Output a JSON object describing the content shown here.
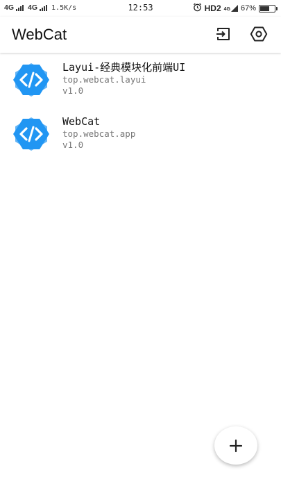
{
  "status_bar": {
    "network1": "4G",
    "network2": "4G",
    "speed": "1.5K/s",
    "time": "12:53",
    "hd": "HD2",
    "mini_4g": "4G",
    "battery_text": "67%",
    "battery_level": 0.67
  },
  "app_bar": {
    "title": "WebCat",
    "actions": [
      "import-icon",
      "settings-icon"
    ]
  },
  "apps": [
    {
      "name": "Layui-经典模块化前端UI",
      "package": "top.webcat.layui",
      "version": "v1.0",
      "icon": "code-star-icon"
    },
    {
      "name": "WebCat",
      "package": "top.webcat.app",
      "version": "v1.0",
      "icon": "code-star-icon"
    }
  ],
  "fab": {
    "icon": "plus-icon"
  },
  "colors": {
    "icon_primary": "#2196F3",
    "icon_light": "#64B5F6",
    "text_primary": "#111111",
    "text_secondary": "#777777"
  }
}
